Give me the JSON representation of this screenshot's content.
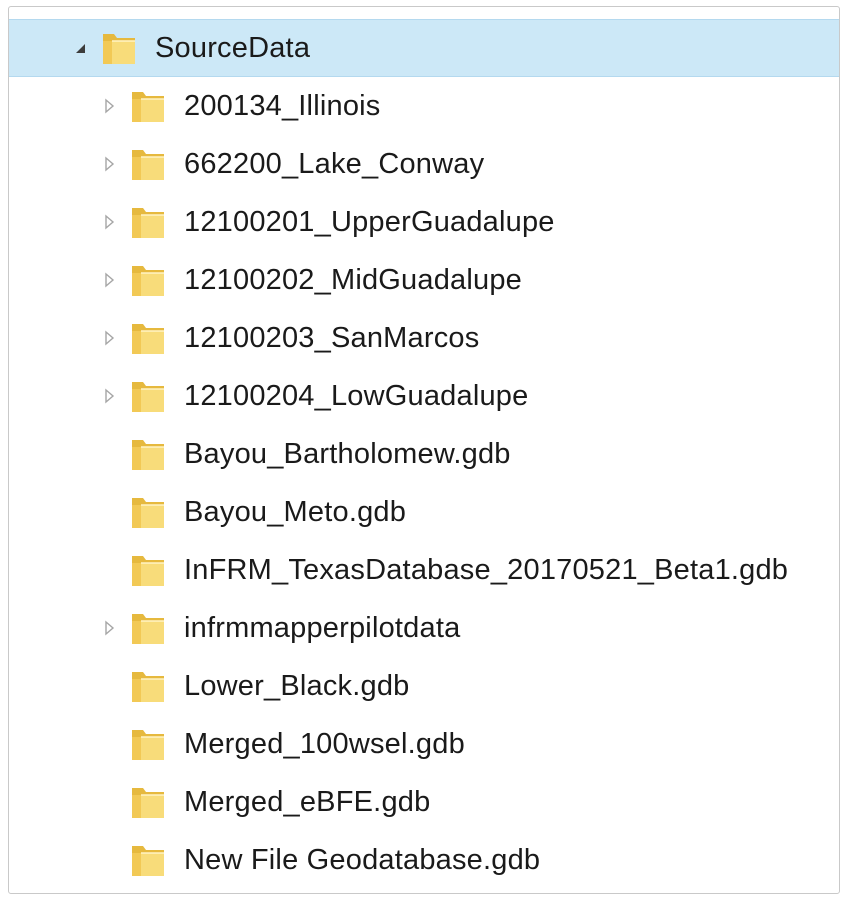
{
  "tree": {
    "root": {
      "label": "SourceData",
      "expanded": true,
      "selected": true,
      "toggle_icon": "expanded-arrow-icon",
      "icon": "folder-open-icon"
    },
    "items": [
      {
        "label": "200134_Illinois",
        "has_children": true,
        "icon": "folder-icon",
        "toggle_icon": "collapsed-arrow-icon"
      },
      {
        "label": "662200_Lake_Conway",
        "has_children": true,
        "icon": "folder-icon",
        "toggle_icon": "collapsed-arrow-icon"
      },
      {
        "label": "12100201_UpperGuadalupe",
        "has_children": true,
        "icon": "folder-icon",
        "toggle_icon": "collapsed-arrow-icon"
      },
      {
        "label": "12100202_MidGuadalupe",
        "has_children": true,
        "icon": "folder-icon",
        "toggle_icon": "collapsed-arrow-icon"
      },
      {
        "label": "12100203_SanMarcos",
        "has_children": true,
        "icon": "folder-icon",
        "toggle_icon": "collapsed-arrow-icon"
      },
      {
        "label": "12100204_LowGuadalupe",
        "has_children": true,
        "icon": "folder-icon",
        "toggle_icon": "collapsed-arrow-icon"
      },
      {
        "label": "Bayou_Bartholomew.gdb",
        "has_children": false,
        "icon": "folder-icon"
      },
      {
        "label": "Bayou_Meto.gdb",
        "has_children": false,
        "icon": "folder-icon"
      },
      {
        "label": "InFRM_TexasDatabase_20170521_Beta1.gdb",
        "has_children": false,
        "icon": "folder-icon"
      },
      {
        "label": "infrmmapperpilotdata",
        "has_children": true,
        "icon": "folder-icon",
        "toggle_icon": "collapsed-arrow-icon"
      },
      {
        "label": "Lower_Black.gdb",
        "has_children": false,
        "icon": "folder-icon"
      },
      {
        "label": "Merged_100wsel.gdb",
        "has_children": false,
        "icon": "folder-icon"
      },
      {
        "label": "Merged_eBFE.gdb",
        "has_children": false,
        "icon": "folder-icon"
      },
      {
        "label": "New File Geodatabase.gdb",
        "has_children": false,
        "icon": "folder-icon"
      }
    ]
  },
  "colors": {
    "selection_bg": "#cce8f7",
    "folder_light": "#f8dc7a",
    "folder_dark": "#e6b93e",
    "text": "#1a1a1a"
  }
}
